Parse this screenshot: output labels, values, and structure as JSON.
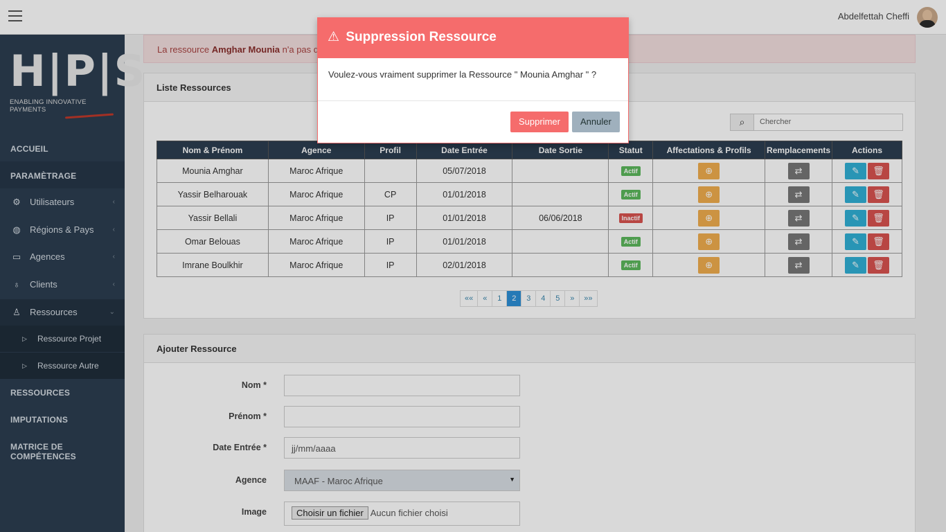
{
  "topbar": {
    "username": "Abdelfettah Cheffi"
  },
  "sidebar": {
    "logo_letters": "H|P|S",
    "logo_tagline": "ENABLING INNOVATIVE PAYMENTS",
    "sections": {
      "accueil": "ACCUEIL",
      "parametrage": "PARAMÈTRAGE",
      "ressources": "RESSOURCES",
      "imputations": "IMPUTATIONS",
      "matrice": "MATRICE DE COMPÉTENCES"
    },
    "items": [
      {
        "label": "Utilisateurs",
        "icon": "gear-icon"
      },
      {
        "label": "Régions & Pays",
        "icon": "globe-icon"
      },
      {
        "label": "Agences",
        "icon": "desktop-icon"
      },
      {
        "label": "Clients",
        "icon": "lightbulb-icon"
      },
      {
        "label": "Ressources",
        "icon": "users-icon"
      }
    ],
    "subitems": [
      {
        "label": "Ressource Projet"
      },
      {
        "label": "Ressource Autre"
      }
    ]
  },
  "alert": {
    "prefix": "La ressource",
    "name": "Amghar Mounia",
    "suffix": "n'a pas d'a"
  },
  "list": {
    "title": "Liste Ressources",
    "search_placeholder": "Chercher",
    "columns": [
      "Nom & Prénom",
      "Agence",
      "Profil",
      "Date Entrée",
      "Date Sortie",
      "Statut",
      "Affectations & Profils",
      "Remplacements",
      "Actions"
    ],
    "rows": [
      {
        "name": "Mounia Amghar",
        "agence": "Maroc Afrique",
        "profil": "",
        "entree": "05/07/2018",
        "sortie": "",
        "statut": "Actif",
        "active": true
      },
      {
        "name": "Yassir Belharouak",
        "agence": "Maroc Afrique",
        "profil": "CP",
        "entree": "01/01/2018",
        "sortie": "",
        "statut": "Actif",
        "active": true
      },
      {
        "name": "Yassir Bellali",
        "agence": "Maroc Afrique",
        "profil": "IP",
        "entree": "01/01/2018",
        "sortie": "06/06/2018",
        "statut": "Inactif",
        "active": false
      },
      {
        "name": "Omar Belouas",
        "agence": "Maroc Afrique",
        "profil": "IP",
        "entree": "01/01/2018",
        "sortie": "",
        "statut": "Actif",
        "active": true
      },
      {
        "name": "Imrane Boulkhir",
        "agence": "Maroc Afrique",
        "profil": "IP",
        "entree": "02/01/2018",
        "sortie": "",
        "statut": "Actif",
        "active": true
      }
    ],
    "pager": [
      "««",
      "«",
      "1",
      "2",
      "3",
      "4",
      "5",
      "»",
      "»»"
    ],
    "current_page": "2"
  },
  "form": {
    "title": "Ajouter Ressource",
    "nom_label": "Nom *",
    "prenom_label": "Prénom *",
    "date_label": "Date Entrée *",
    "date_value": "jj/mm/aaaa",
    "agence_label": "Agence",
    "agence_value": "MAAF - Maroc Afrique",
    "image_label": "Image",
    "file_button": "Choisir un fichier",
    "file_status": "Aucun fichier choisi"
  },
  "modal": {
    "title": "Suppression Ressource",
    "message": "Voulez-vous vraiment supprimer la Ressource \" Mounia Amghar \" ?",
    "confirm": "Supprimer",
    "cancel": "Annuler"
  },
  "colors": {
    "sidebar": "#2c3e50",
    "modal_header": "#f56c6c",
    "alert_bg": "#f2dede"
  }
}
